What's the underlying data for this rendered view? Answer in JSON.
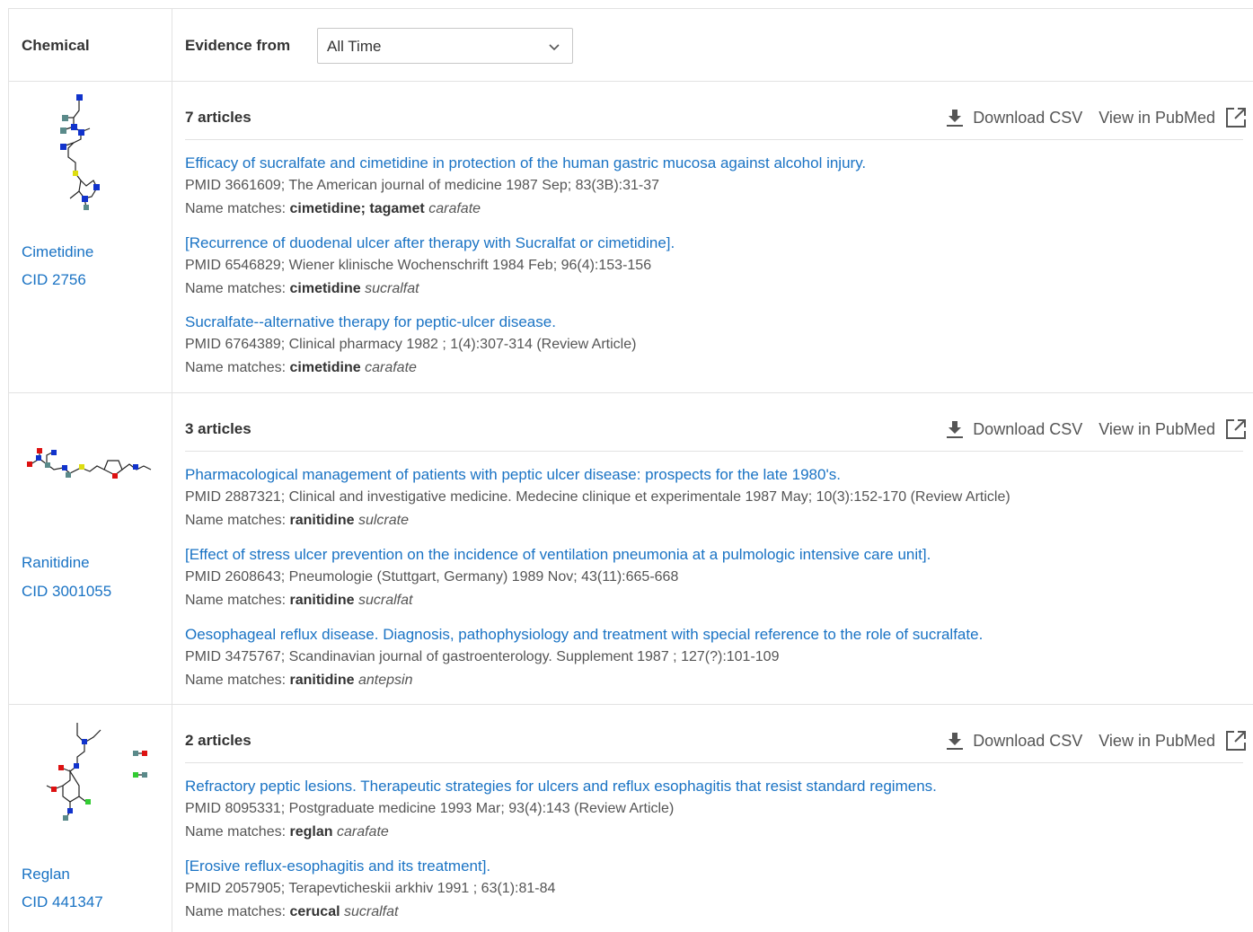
{
  "header": {
    "chemical_label": "Chemical",
    "evidence_label": "Evidence from",
    "evidence_select": "All Time"
  },
  "actions": {
    "download": "Download CSV",
    "pubmed": "View in PubMed"
  },
  "rows": [
    {
      "name": "Cimetidine",
      "cid": "CID 2756",
      "count": "7 articles",
      "articles": [
        {
          "title": "Efficacy of sucralfate and cimetidine in protection of the human gastric mucosa against alcohol injury.",
          "meta": "PMID 3661609; The American journal of medicine 1987 Sep; 83(3B):31-37",
          "match_label": "Name matches:",
          "match_bold": "cimetidine; tagamet",
          "match_italic": "carafate"
        },
        {
          "title": "[Recurrence of duodenal ulcer after therapy with Sucralfat or cimetidine].",
          "meta": "PMID 6546829; Wiener klinische Wochenschrift 1984 Feb; 96(4):153-156",
          "match_label": "Name matches:",
          "match_bold": "cimetidine",
          "match_italic": "sucralfat"
        },
        {
          "title": "Sucralfate--alternative therapy for peptic-ulcer disease.",
          "meta": "PMID 6764389; Clinical pharmacy 1982 ; 1(4):307-314 (Review Article)",
          "match_label": "Name matches:",
          "match_bold": "cimetidine",
          "match_italic": "carafate"
        }
      ]
    },
    {
      "name": "Ranitidine",
      "cid": "CID 3001055",
      "count": "3 articles",
      "articles": [
        {
          "title": "Pharmacological management of patients with peptic ulcer disease: prospects for the late 1980's.",
          "meta": "PMID 2887321; Clinical and investigative medicine. Medecine clinique et experimentale 1987 May; 10(3):152-170 (Review Article)",
          "match_label": "Name matches:",
          "match_bold": "ranitidine",
          "match_italic": "sulcrate"
        },
        {
          "title": "[Effect of stress ulcer prevention on the incidence of ventilation pneumonia at a pulmologic intensive care unit].",
          "meta": "PMID 2608643; Pneumologie (Stuttgart, Germany) 1989 Nov; 43(11):665-668",
          "match_label": "Name matches:",
          "match_bold": "ranitidine",
          "match_italic": "sucralfat"
        },
        {
          "title": "Oesophageal reflux disease. Diagnosis, pathophysiology and treatment with special reference to the role of sucralfate.",
          "meta": "PMID 3475767; Scandinavian journal of gastroenterology. Supplement 1987 ; 127(?):101-109",
          "match_label": "Name matches:",
          "match_bold": "ranitidine",
          "match_italic": "antepsin"
        }
      ]
    },
    {
      "name": "Reglan",
      "cid": "CID 441347",
      "count": "2 articles",
      "articles": [
        {
          "title": "Refractory peptic lesions. Therapeutic strategies for ulcers and reflux esophagitis that resist standard regimens.",
          "meta": "PMID 8095331; Postgraduate medicine 1993 Mar; 93(4):143 (Review Article)",
          "match_label": "Name matches:",
          "match_bold": "reglan",
          "match_italic": "carafate"
        },
        {
          "title": "[Erosive reflux-esophagitis and its treatment].",
          "meta": "PMID 2057905; Terapevticheskii arkhiv 1991 ; 63(1):81-84",
          "match_label": "Name matches:",
          "match_bold": "cerucal",
          "match_italic": "sucralfat"
        }
      ]
    }
  ]
}
